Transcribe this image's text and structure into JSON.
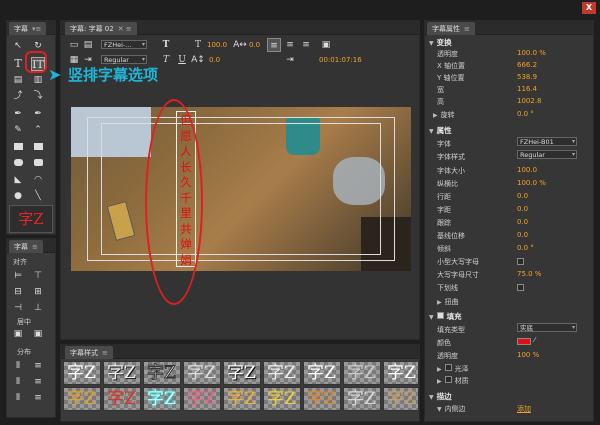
{
  "window": {
    "close_label": "X"
  },
  "tools_panel": {
    "tab_label": "字幕",
    "title_sample": "字Z"
  },
  "align_panel": {
    "tab_label": "字幕",
    "align_label": "对齐",
    "center_label": "居中",
    "distribute_label": "分布"
  },
  "annotation": {
    "callout_text": "竖排字幕选项"
  },
  "title_panel": {
    "tab_label": "字幕: 字幕 02",
    "font_value": "FZHei-...",
    "style_value": "Regular",
    "size_value": "100.0",
    "kerning_value": "0.0",
    "leading_value": "0.0",
    "timecode": "00:01:07:16",
    "vertical_text": "但愿人长久千里共婵娟"
  },
  "styles_panel": {
    "tab_label": "字幕样式",
    "sample_glyph": "字Z"
  },
  "props_panel": {
    "tab_label": "字幕属性",
    "transform": {
      "label": "变换",
      "rows": [
        {
          "label": "透明度",
          "value": "100.0 %"
        },
        {
          "label": "X 轴位置",
          "value": "666.2"
        },
        {
          "label": "Y 轴位置",
          "value": "538.9"
        },
        {
          "label": "宽",
          "value": "116.4"
        },
        {
          "label": "高",
          "value": "1002.8"
        },
        {
          "label": "旋转",
          "value": "0.0 °"
        }
      ]
    },
    "properties": {
      "label": "属性",
      "font_label": "字体",
      "font_value": "FZHei-B01",
      "style_label": "字体样式",
      "style_value": "Regular",
      "rows": [
        {
          "label": "字体大小",
          "value": "100.0"
        },
        {
          "label": "纵横比",
          "value": "100.0 %"
        },
        {
          "label": "行距",
          "value": "0.0"
        },
        {
          "label": "字距",
          "value": "0.0"
        },
        {
          "label": "跟踪",
          "value": "0.0"
        },
        {
          "label": "基线位移",
          "value": "0.0"
        },
        {
          "label": "倾斜",
          "value": "0.0 °"
        }
      ],
      "smallcaps_label": "小型大写字母",
      "smallcaps_size_label": "大写字母尺寸",
      "smallcaps_size_value": "75.0 %",
      "underline_label": "下划线",
      "distort_label": "扭曲"
    },
    "fill": {
      "label": "填充",
      "type_label": "填充类型",
      "type_value": "实底",
      "color_label": "颜色",
      "color_hex": "#e01010",
      "opacity_label": "透明度",
      "opacity_value": "100 %",
      "sheen_label": "光泽",
      "texture_label": "材质"
    },
    "stroke": {
      "label": "描边",
      "inner_label": "内侧边",
      "add_label": "添加"
    }
  },
  "colors": {
    "accent_value": "#f2a324",
    "annotation": "#e02020",
    "callout_text": "#1fb5d8"
  }
}
